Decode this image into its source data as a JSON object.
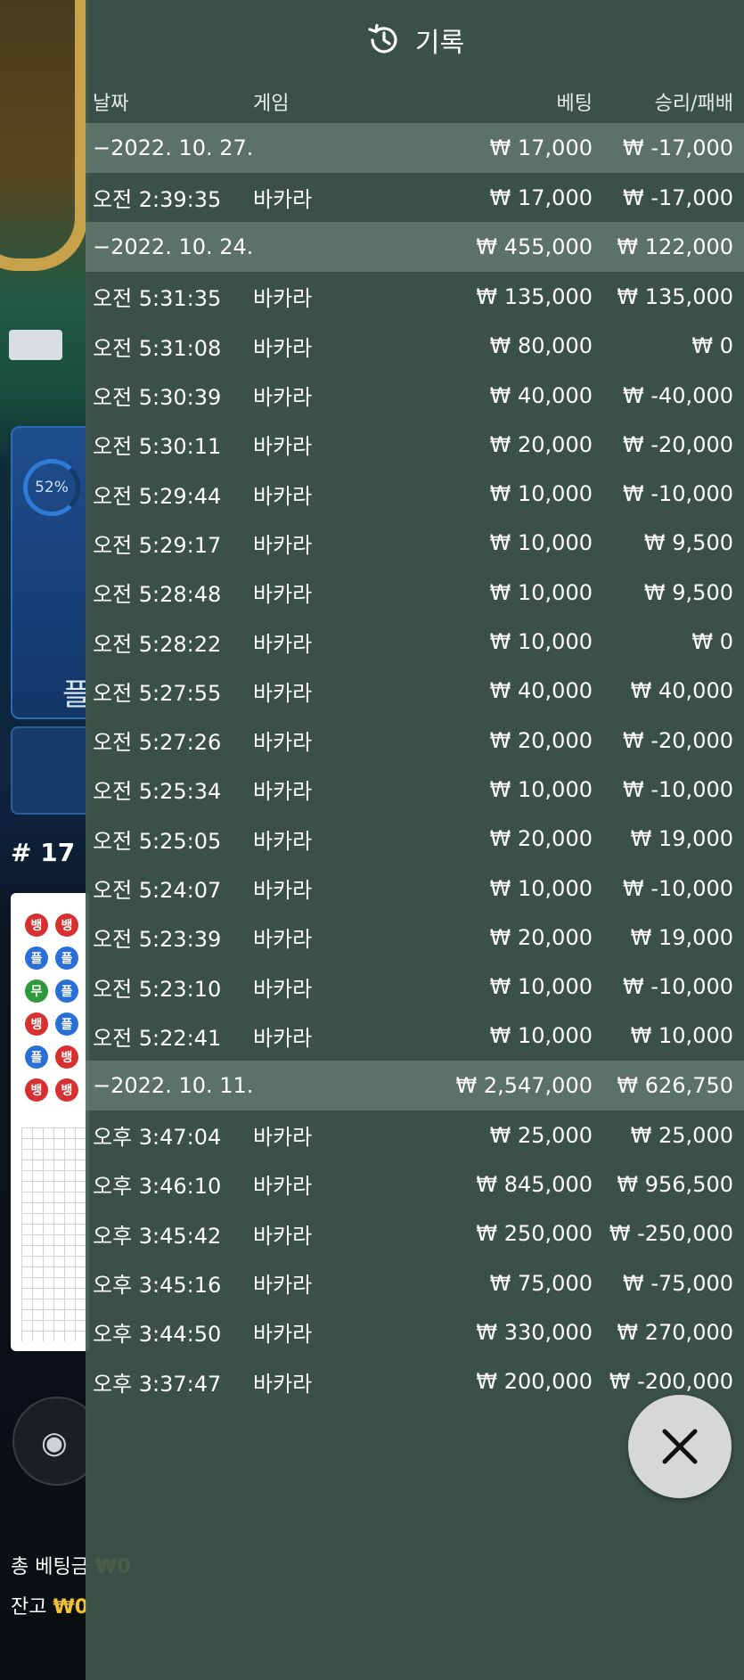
{
  "panel": {
    "title": "기록",
    "columns": {
      "date": "날짜",
      "game": "게임",
      "bet": "베팅",
      "win": "승리/패배"
    },
    "groups": [
      {
        "date": "−2022. 10. 27.",
        "bet": "₩ 17,000",
        "win": "₩ -17,000",
        "items": [
          {
            "time": "오전 2:39:35",
            "game": "바카라",
            "bet": "₩ 17,000",
            "win": "₩ -17,000"
          }
        ]
      },
      {
        "date": "−2022. 10. 24.",
        "bet": "₩ 455,000",
        "win": "₩ 122,000",
        "items": [
          {
            "time": "오전 5:31:35",
            "game": "바카라",
            "bet": "₩ 135,000",
            "win": "₩ 135,000"
          },
          {
            "time": "오전 5:31:08",
            "game": "바카라",
            "bet": "₩ 80,000",
            "win": "₩ 0"
          },
          {
            "time": "오전 5:30:39",
            "game": "바카라",
            "bet": "₩ 40,000",
            "win": "₩ -40,000"
          },
          {
            "time": "오전 5:30:11",
            "game": "바카라",
            "bet": "₩ 20,000",
            "win": "₩ -20,000"
          },
          {
            "time": "오전 5:29:44",
            "game": "바카라",
            "bet": "₩ 10,000",
            "win": "₩ -10,000"
          },
          {
            "time": "오전 5:29:17",
            "game": "바카라",
            "bet": "₩ 10,000",
            "win": "₩ 9,500"
          },
          {
            "time": "오전 5:28:48",
            "game": "바카라",
            "bet": "₩ 10,000",
            "win": "₩ 9,500"
          },
          {
            "time": "오전 5:28:22",
            "game": "바카라",
            "bet": "₩ 10,000",
            "win": "₩ 0"
          },
          {
            "time": "오전 5:27:55",
            "game": "바카라",
            "bet": "₩ 40,000",
            "win": "₩ 40,000"
          },
          {
            "time": "오전 5:27:26",
            "game": "바카라",
            "bet": "₩ 20,000",
            "win": "₩ -20,000"
          },
          {
            "time": "오전 5:25:34",
            "game": "바카라",
            "bet": "₩ 10,000",
            "win": "₩ -10,000"
          },
          {
            "time": "오전 5:25:05",
            "game": "바카라",
            "bet": "₩ 20,000",
            "win": "₩ 19,000"
          },
          {
            "time": "오전 5:24:07",
            "game": "바카라",
            "bet": "₩ 10,000",
            "win": "₩ -10,000"
          },
          {
            "time": "오전 5:23:39",
            "game": "바카라",
            "bet": "₩ 20,000",
            "win": "₩ 19,000"
          },
          {
            "time": "오전 5:23:10",
            "game": "바카라",
            "bet": "₩ 10,000",
            "win": "₩ -10,000"
          },
          {
            "time": "오전 5:22:41",
            "game": "바카라",
            "bet": "₩ 10,000",
            "win": "₩ 10,000"
          }
        ]
      },
      {
        "date": "−2022. 10. 11.",
        "bet": "₩ 2,547,000",
        "win": "₩ 626,750",
        "items": [
          {
            "time": "오후 3:47:04",
            "game": "바카라",
            "bet": "₩ 25,000",
            "win": "₩ 25,000"
          },
          {
            "time": "오후 3:46:10",
            "game": "바카라",
            "bet": "₩ 845,000",
            "win": "₩ 956,500"
          },
          {
            "time": "오후 3:45:42",
            "game": "바카라",
            "bet": "₩ 250,000",
            "win": "₩ -250,000"
          },
          {
            "time": "오후 3:45:16",
            "game": "바카라",
            "bet": "₩ 75,000",
            "win": "₩ -75,000"
          },
          {
            "time": "오후 3:44:50",
            "game": "바카라",
            "bet": "₩ 330,000",
            "win": "₩ 270,000"
          },
          {
            "time": "오후 3:37:47",
            "game": "바카라",
            "bet": "₩ 200,000",
            "win": "₩ -200,000"
          }
        ]
      }
    ]
  },
  "background": {
    "progress": "52%",
    "player_glyph": "플",
    "round": "# 17",
    "beads": [
      [
        "뱅",
        "뱅"
      ],
      [
        "플",
        "플"
      ],
      [
        "무",
        "플"
      ],
      [
        "뱅",
        "플"
      ],
      [
        "플",
        "뱅"
      ],
      [
        "뱅",
        "뱅"
      ]
    ],
    "bead_colors": {
      "뱅": "#d63030",
      "플": "#2a6fd6",
      "무": "#2f9a3c"
    },
    "total_bet_label": "총 베팅금",
    "total_bet_value": "₩0",
    "balance_label": "잔고",
    "balance_value": "₩0"
  }
}
